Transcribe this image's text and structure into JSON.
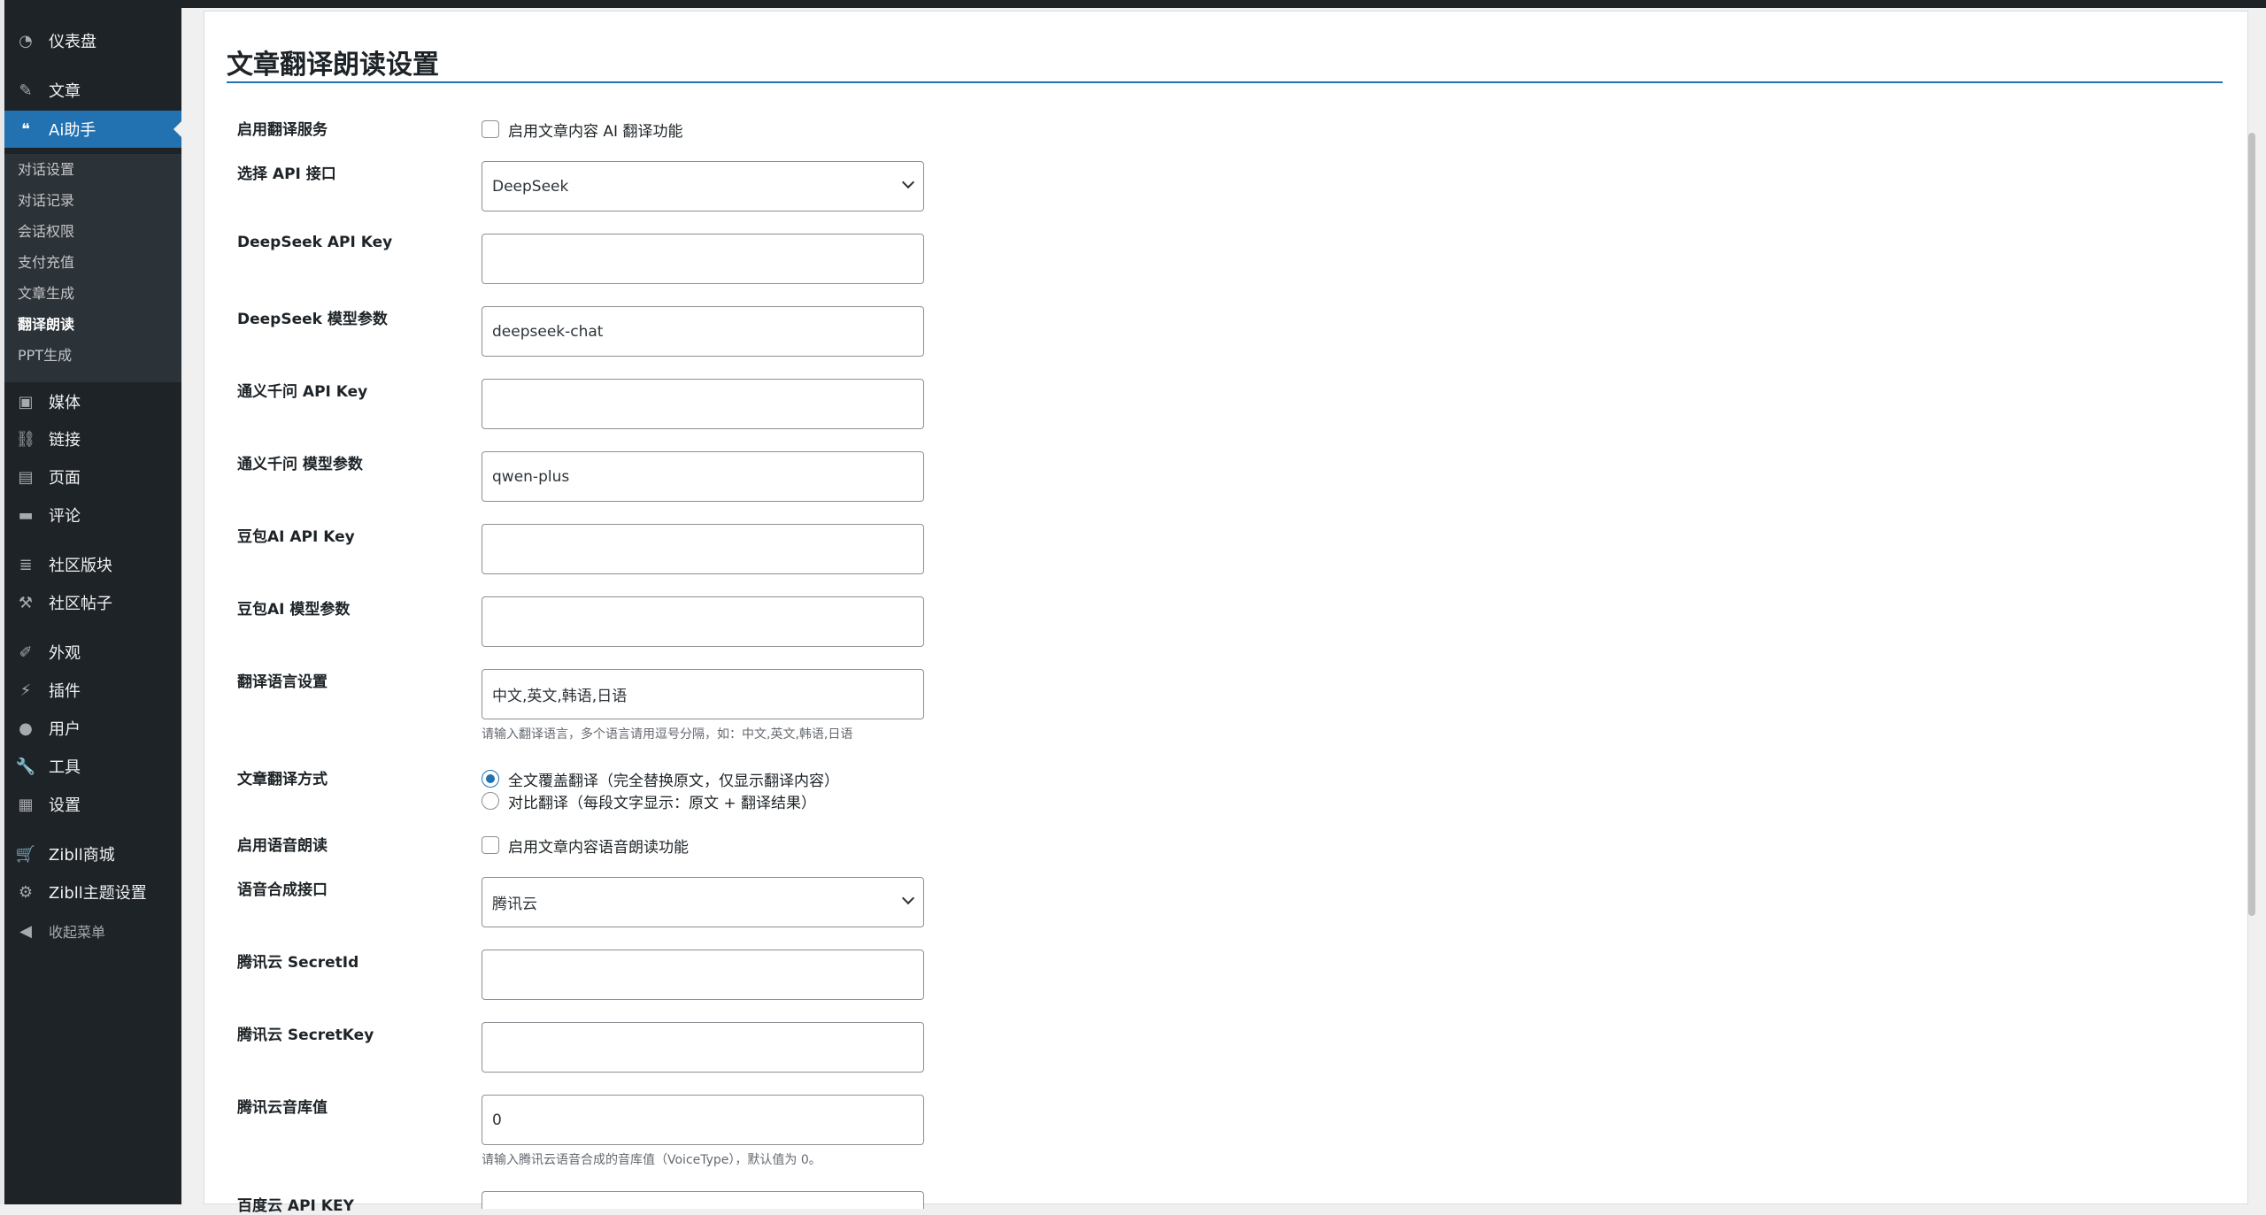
{
  "sidebar": {
    "items": [
      {
        "label": "仪表盘",
        "icon": "dashboard-icon",
        "glyph": "◔"
      },
      {
        "label": "文章",
        "icon": "pin-icon",
        "glyph": "✎"
      },
      {
        "label": "Ai助手",
        "icon": "chat-icon",
        "glyph": "❝"
      },
      {
        "label": "媒体",
        "icon": "media-icon",
        "glyph": "▣"
      },
      {
        "label": "链接",
        "icon": "link-icon",
        "glyph": "⛓"
      },
      {
        "label": "页面",
        "icon": "page-icon",
        "glyph": "▤"
      },
      {
        "label": "评论",
        "icon": "comment-icon",
        "glyph": "▬"
      },
      {
        "label": "社区版块",
        "icon": "layers-icon",
        "glyph": "≣"
      },
      {
        "label": "社区帖子",
        "icon": "hammer-icon",
        "glyph": "⚒"
      },
      {
        "label": "外观",
        "icon": "brush-icon",
        "glyph": "✐"
      },
      {
        "label": "插件",
        "icon": "plugin-icon",
        "glyph": "⚡"
      },
      {
        "label": "用户",
        "icon": "user-icon",
        "glyph": "●"
      },
      {
        "label": "工具",
        "icon": "wrench-icon",
        "glyph": "🔧"
      },
      {
        "label": "设置",
        "icon": "settings-icon",
        "glyph": "▦"
      },
      {
        "label": "Zibll商城",
        "icon": "cart-icon",
        "glyph": "🛒"
      },
      {
        "label": "Zibll主题设置",
        "icon": "gear-icon",
        "glyph": "⚙"
      },
      {
        "label": "收起菜单",
        "icon": "collapse-icon",
        "glyph": "◀"
      }
    ],
    "submenu": [
      "对话设置",
      "对话记录",
      "会话权限",
      "支付充值",
      "文章生成",
      "翻译朗读",
      "PPT生成"
    ]
  },
  "page": {
    "title": "文章翻译朗读设置"
  },
  "form": {
    "enable_translation": {
      "label": "启用翻译服务",
      "option": "启用文章内容 AI 翻译功能"
    },
    "api_select": {
      "label": "选择 API 接口",
      "value": "DeepSeek"
    },
    "deepseek_key": {
      "label": "DeepSeek API Key",
      "value": ""
    },
    "deepseek_model": {
      "label": "DeepSeek 模型参数",
      "value": "deepseek-chat"
    },
    "qwen_key": {
      "label": "通义千问 API Key",
      "value": ""
    },
    "qwen_model": {
      "label": "通义千问 模型参数",
      "value": "qwen-plus"
    },
    "doubao_key": {
      "label": "豆包AI API Key",
      "value": ""
    },
    "doubao_model": {
      "label": "豆包AI 模型参数",
      "value": ""
    },
    "languages": {
      "label": "翻译语言设置",
      "value": "中文,英文,韩语,日语",
      "help": "请输入翻译语言，多个语言请用逗号分隔，如：中文,英文,韩语,日语"
    },
    "mode": {
      "label": "文章翻译方式",
      "options": [
        "全文覆盖翻译（完全替换原文，仅显示翻译内容）",
        "对比翻译（每段文字显示：原文 + 翻译结果）"
      ]
    },
    "enable_tts": {
      "label": "启用语音朗读",
      "option": "启用文章内容语音朗读功能"
    },
    "tts_api": {
      "label": "语音合成接口",
      "value": "腾讯云"
    },
    "tencent_id": {
      "label": "腾讯云 SecretId",
      "value": ""
    },
    "tencent_key": {
      "label": "腾讯云 SecretKey",
      "value": ""
    },
    "tencent_voice": {
      "label": "腾讯云音库值",
      "value": "0",
      "help": "请输入腾讯云语音合成的音库值（VoiceType），默认值为 0。"
    },
    "baidu_key": {
      "label": "百度云 API KEY"
    }
  },
  "colors": {
    "accent": "#2271b1",
    "sidebar_bg": "#1d2327"
  }
}
